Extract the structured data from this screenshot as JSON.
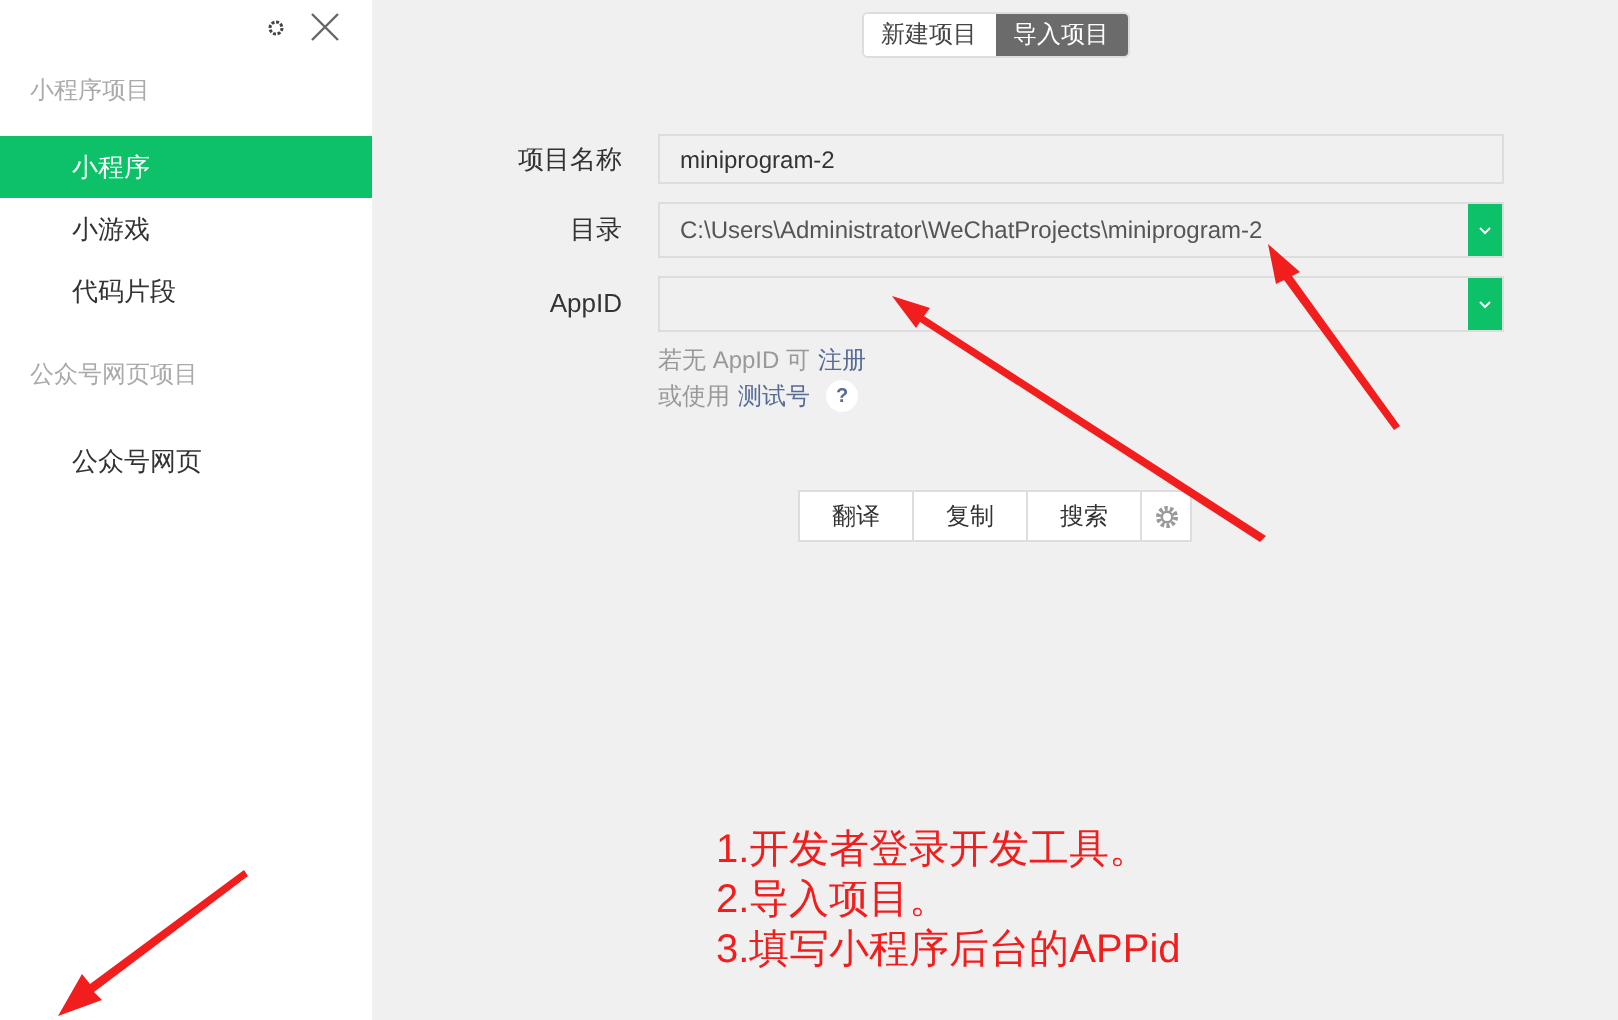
{
  "sidebar": {
    "sections": [
      {
        "title": "小程序项目",
        "items": [
          {
            "label": "小程序",
            "selected": true
          },
          {
            "label": "小游戏",
            "selected": false
          },
          {
            "label": "代码片段",
            "selected": false
          }
        ]
      },
      {
        "title": "公众号网页项目",
        "items": [
          {
            "label": "公众号网页",
            "selected": false
          }
        ]
      }
    ]
  },
  "tabs": [
    {
      "label": "新建项目",
      "selected": false
    },
    {
      "label": "导入项目",
      "selected": true
    }
  ],
  "form": {
    "fields": [
      {
        "label": "项目名称",
        "kind": "text",
        "value": "miniprogram-2"
      },
      {
        "label": "目录",
        "kind": "dropdown",
        "value": "C:\\Users\\Administrator\\WeChatProjects\\miniprogram-2"
      },
      {
        "label": "AppID",
        "kind": "dropdown"
      }
    ],
    "hints": [
      {
        "text": "若无 AppID 可",
        "link": "注册"
      },
      {
        "text": "或使用",
        "link": "测试号",
        "help": "?"
      }
    ]
  },
  "toolbar": {
    "buttons": [
      "翻译",
      "复制",
      "搜索"
    ]
  },
  "annotation": {
    "lines": [
      "1.开发者登录开发工具。",
      "2.导入项目。",
      "3.填写小程序后台的APPid"
    ]
  }
}
